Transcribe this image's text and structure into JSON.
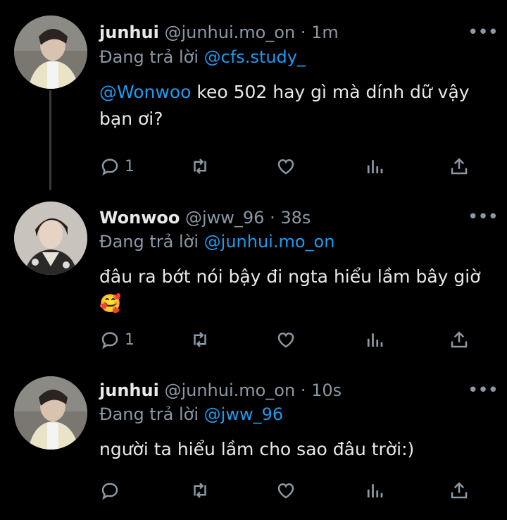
{
  "tweets": [
    {
      "name": "junhui",
      "handle": "@junhui.mo_on",
      "time": "1m",
      "replying_prefix": "Đang trả lời",
      "replying_to": "@cfs.study_",
      "mention": "@Wonwoo",
      "text": " keo 502 hay gì mà dính dữ vậy bạn ơi?",
      "reply_count": "1",
      "more_icon": "more-icon"
    },
    {
      "name": "Wonwoo",
      "handle": "@jww_96",
      "time": "38s",
      "replying_prefix": "Đang trả lời",
      "replying_to": "@junhui.mo_on",
      "text": "đâu ra bớt nói bậy đi ngta hiểu lầm bây giờ",
      "emoji": "🥰",
      "reply_count": "1"
    },
    {
      "name": "junhui",
      "handle": "@junhui.mo_on",
      "time": "10s",
      "replying_prefix": "Đang trả lời",
      "replying_to": "@jww_96",
      "text": "người ta hiểu lầm cho sao đâu trời:)",
      "reply_count": ""
    }
  ],
  "separator": "·",
  "colors": {
    "background": "#000000",
    "text": "#e7e9ea",
    "muted": "#8b98a5",
    "accent": "#1d9bf0"
  }
}
